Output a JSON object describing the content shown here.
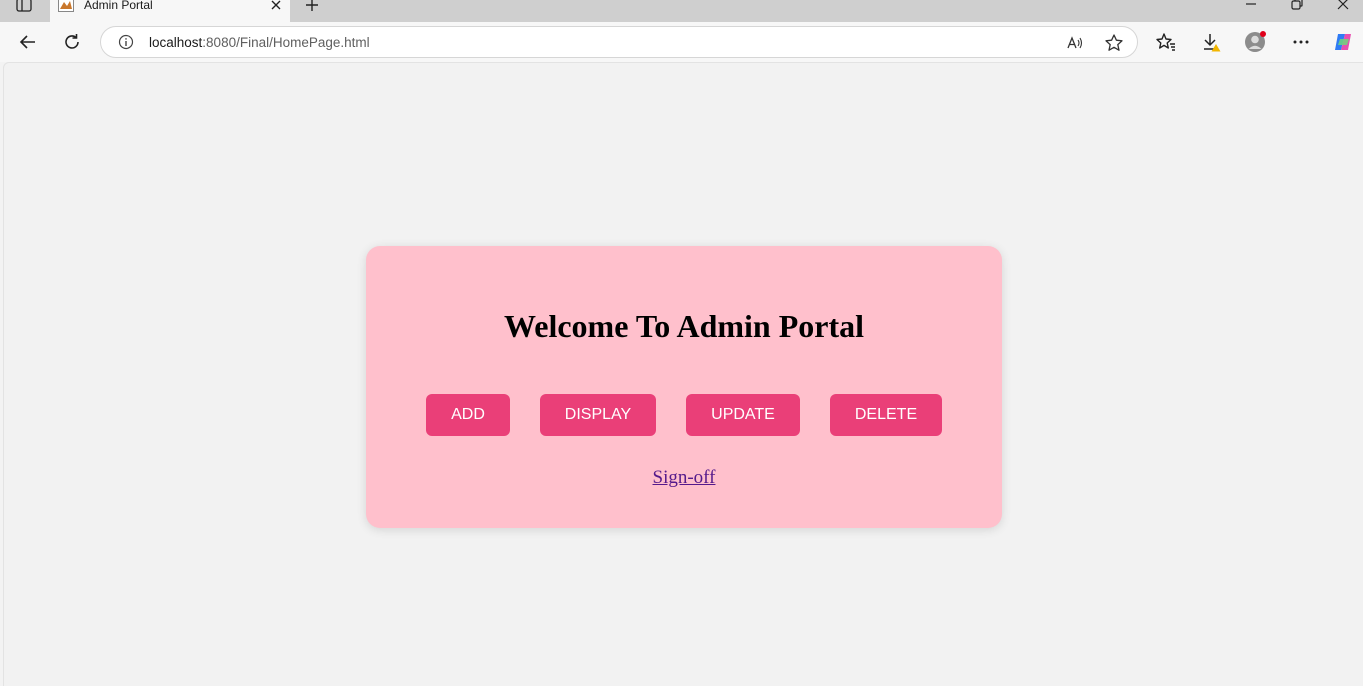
{
  "browser": {
    "tab_title": "Admin Portal",
    "url_host": "localhost",
    "url_path": ":8080/Final/HomePage.html"
  },
  "page": {
    "heading": "Welcome To Admin Portal",
    "buttons": {
      "add": "ADD",
      "display": "DISPLAY",
      "update": "UPDATE",
      "delete": "DELETE"
    },
    "signoff_link": "Sign-off"
  },
  "colors": {
    "card_background": "#ffc0cc",
    "button_background": "#ea3f78",
    "link_color": "#551a8b"
  }
}
